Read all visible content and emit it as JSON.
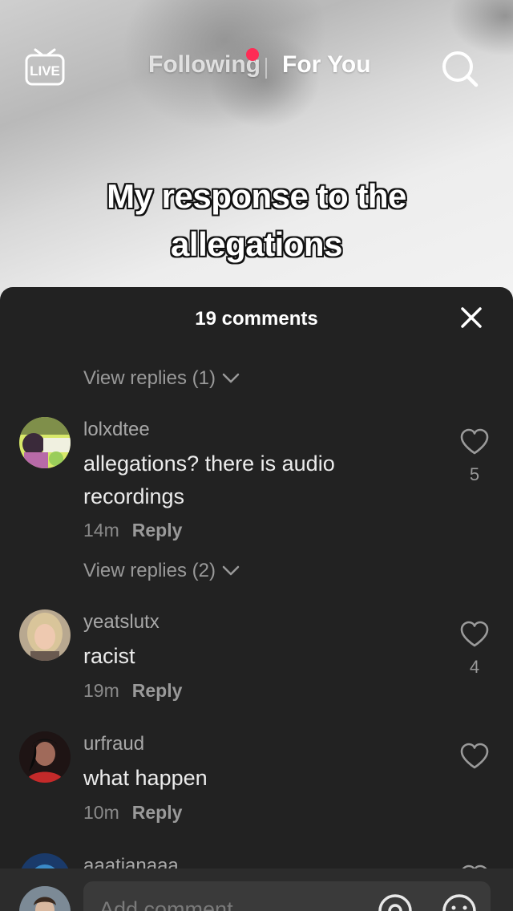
{
  "top_nav": {
    "live_label": "LIVE",
    "following_label": "Following",
    "for_you_label": "For You"
  },
  "video": {
    "caption": "My response to the allegations"
  },
  "comments_sheet": {
    "title": "19 comments",
    "top_view_replies": "View replies (1)",
    "comments": [
      {
        "username": "lolxdtee",
        "text": "allegations? there is audio recordings",
        "time": "14m",
        "reply_label": "Reply",
        "likes": "5",
        "view_replies": "View replies (2)"
      },
      {
        "username": "yeatslutx",
        "text": "racist",
        "time": "19m",
        "reply_label": "Reply",
        "likes": "4"
      },
      {
        "username": "urfraud",
        "text": "what happen",
        "time": "10m",
        "reply_label": "Reply",
        "likes": ""
      },
      {
        "username": "aaatianaaa"
      }
    ]
  },
  "input_bar": {
    "placeholder": "Add comment..."
  },
  "colors": {
    "accent_dot": "#fe2c55",
    "sheet_bg": "#222222"
  },
  "icons": [
    "live-icon",
    "search-icon",
    "close-icon",
    "chevron-down-icon",
    "heart-icon",
    "mention-icon",
    "emoji-icon"
  ]
}
